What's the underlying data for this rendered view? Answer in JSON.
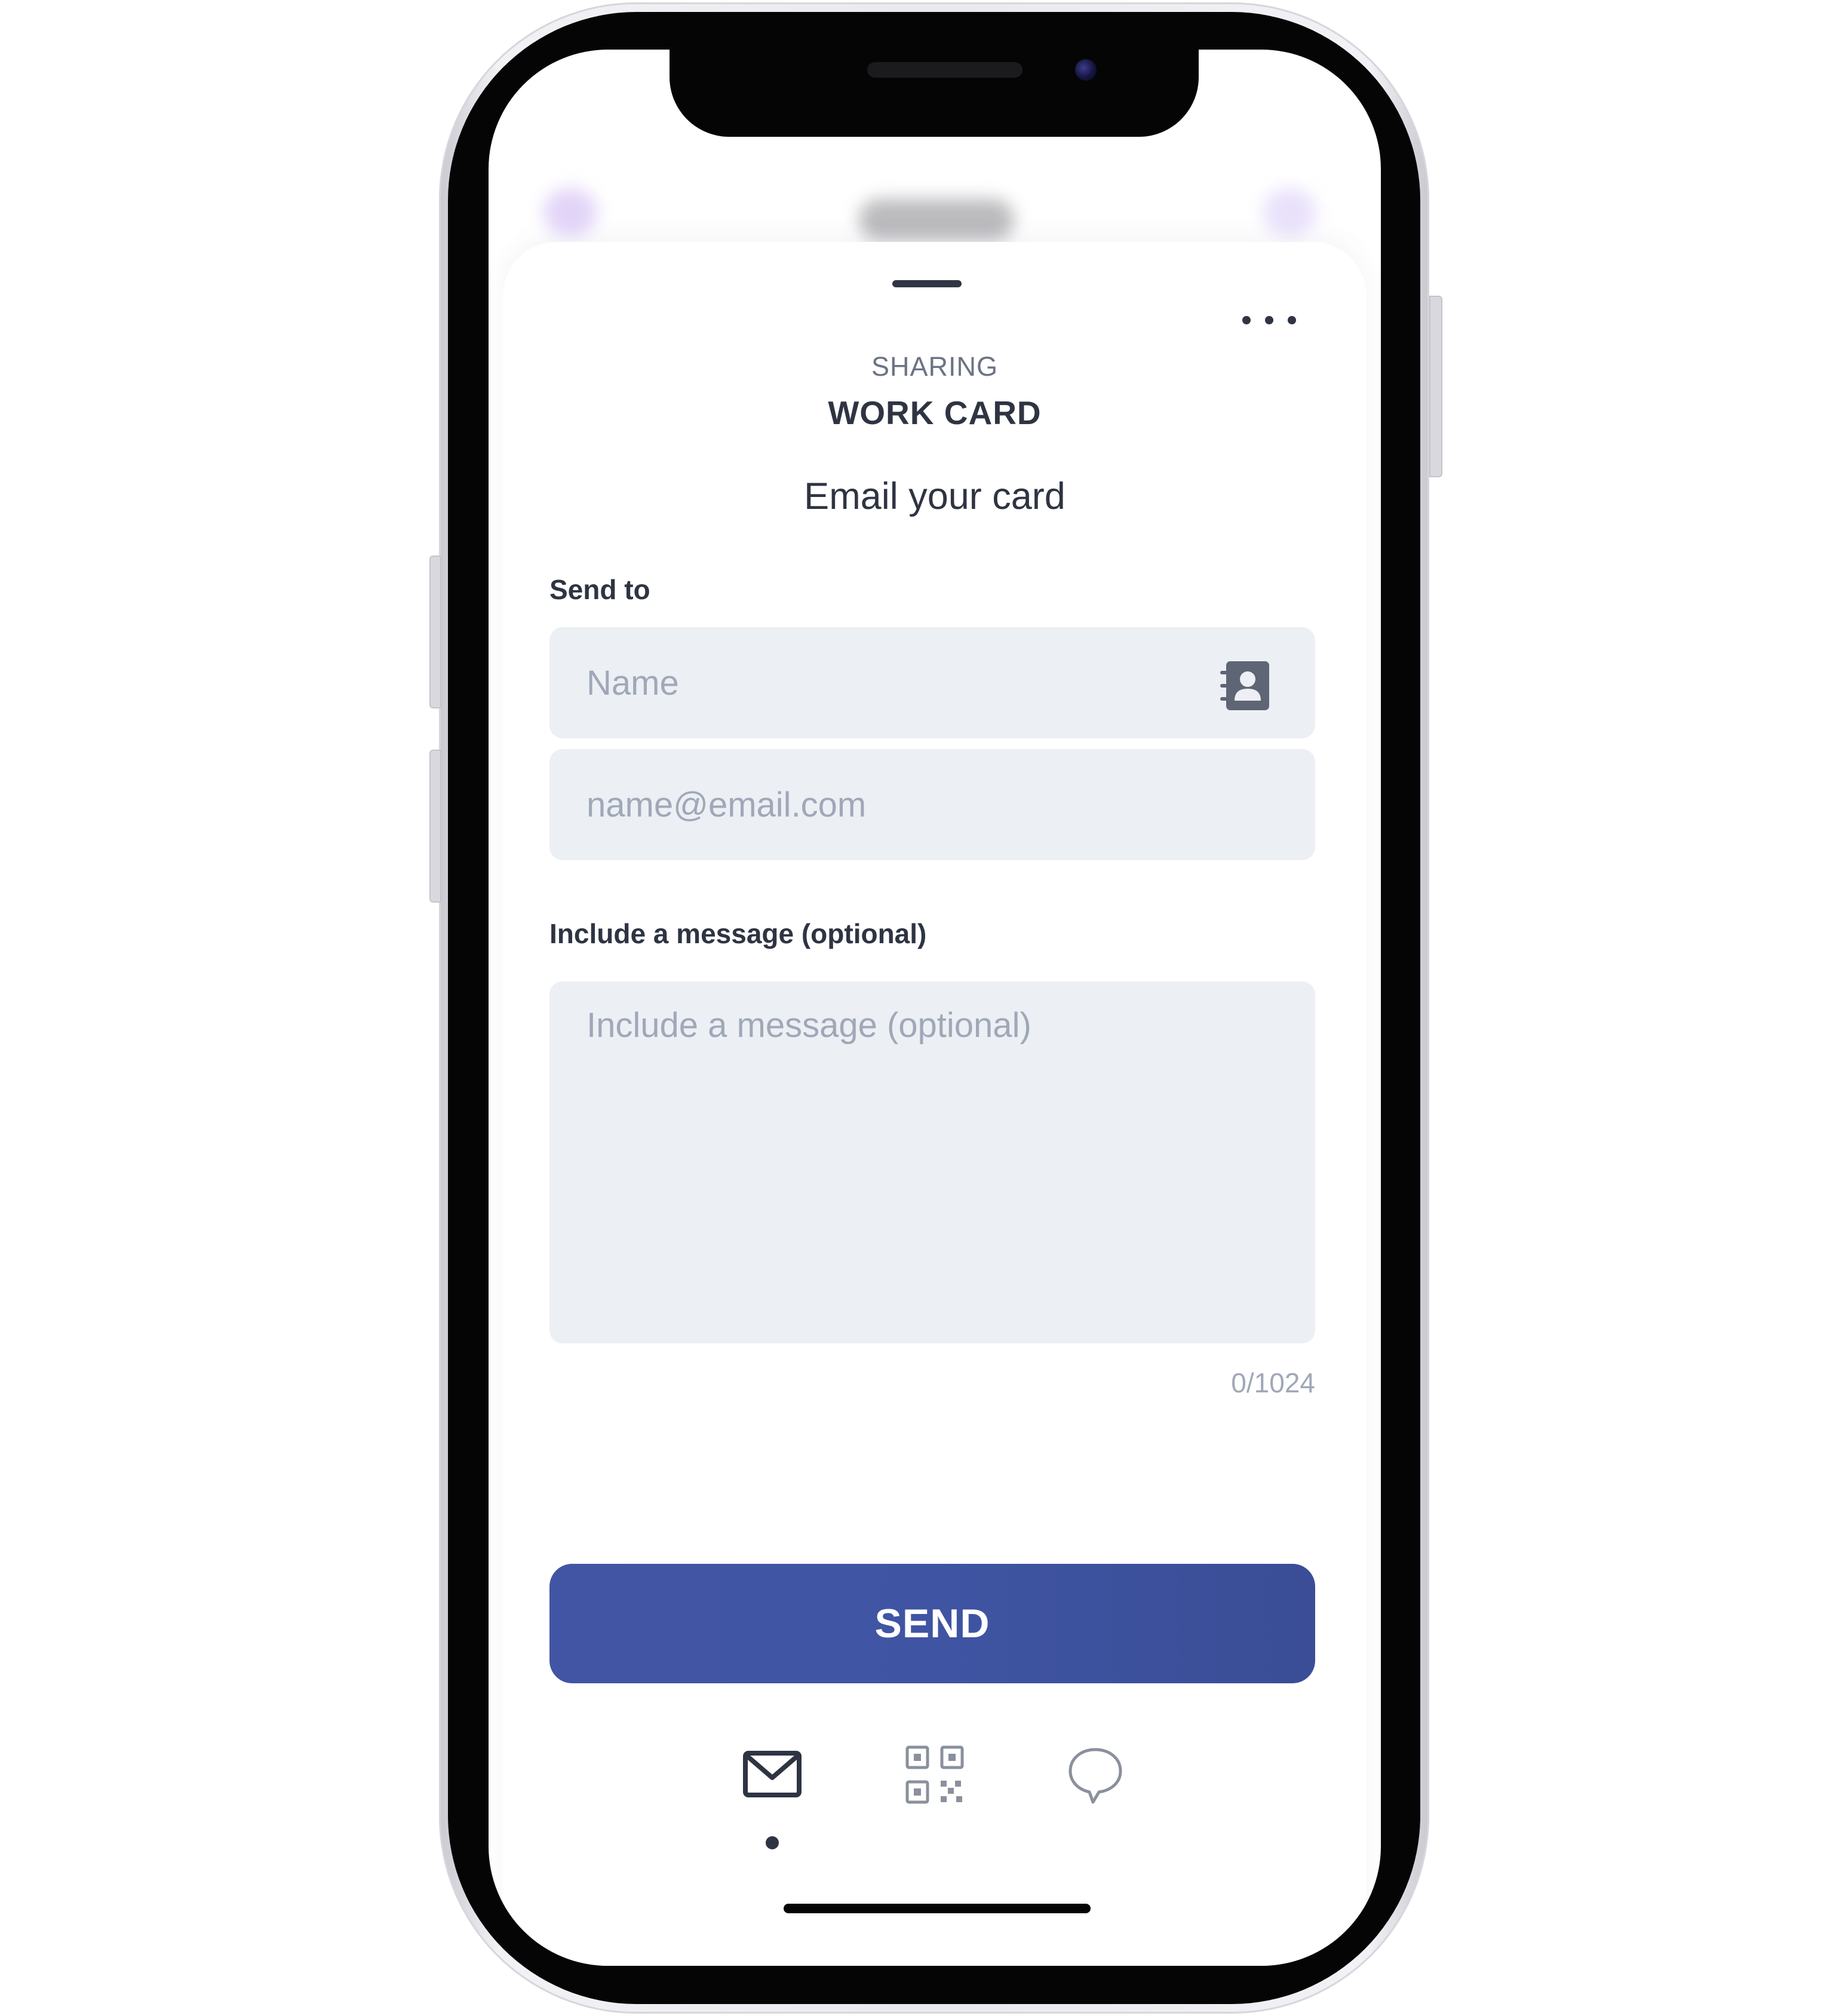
{
  "sheet": {
    "subtitle": "SHARING",
    "title": "WORK CARD",
    "heading": "Email your card"
  },
  "form": {
    "send_to_label": "Send to",
    "name_placeholder": "Name",
    "email_placeholder": "name@email.com",
    "message_label": "Include a message (optional)",
    "message_placeholder": "Include a message (optional)",
    "char_counter": "0/1024"
  },
  "actions": {
    "send_label": "SEND"
  },
  "share_tabs": {
    "items": [
      {
        "icon": "email-icon",
        "active": true
      },
      {
        "icon": "qr-code-icon",
        "active": false
      },
      {
        "icon": "chat-bubble-icon",
        "active": false
      }
    ]
  },
  "colors": {
    "accent": "#3f55a3",
    "field_bg": "#eceff4",
    "text_dark": "#2e3442",
    "placeholder": "#a0a8b8"
  }
}
